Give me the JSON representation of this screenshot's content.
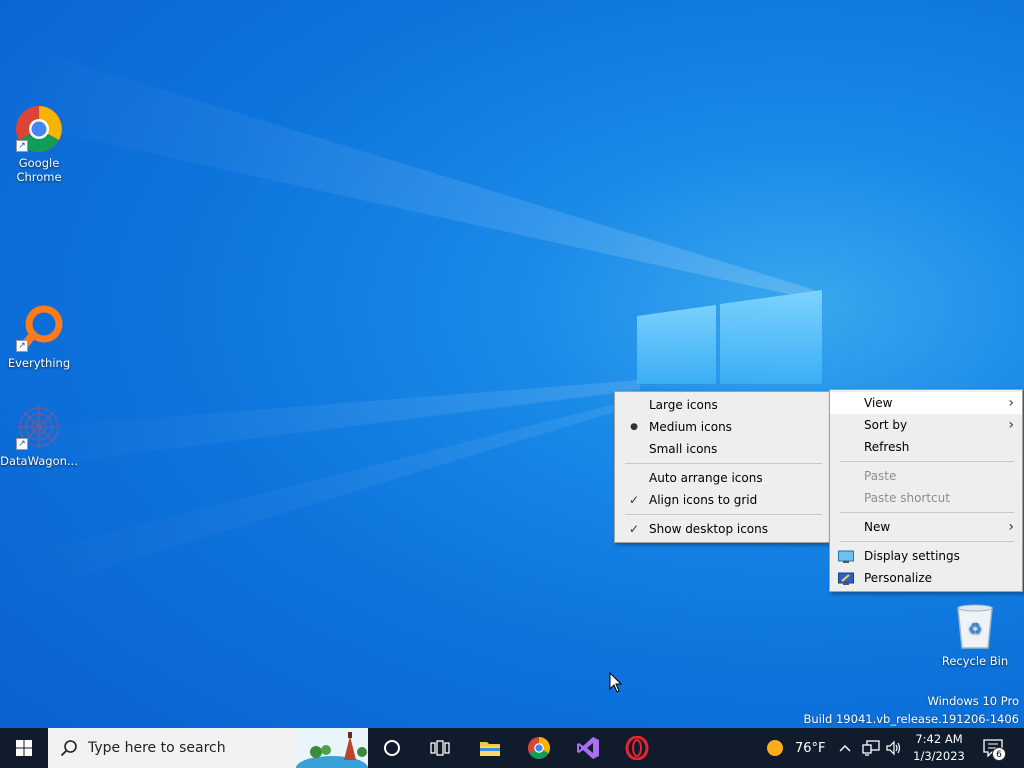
{
  "desktop": {
    "icons": [
      {
        "label": "Google\nChrome",
        "icon": "chrome-icon"
      },
      {
        "label": "Everything",
        "icon": "everything-search-icon"
      },
      {
        "label": "DataWagon...",
        "icon": "datawagon-icon"
      },
      {
        "label": "Recycle Bin",
        "icon": "recycle-bin-icon"
      }
    ],
    "watermark": {
      "line1": "Windows 10 Pro",
      "line2": "Build 19041.vb_release.191206-1406"
    }
  },
  "view_submenu": {
    "items": [
      {
        "label": "Large icons",
        "mark": ""
      },
      {
        "label": "Medium icons",
        "mark": "●"
      },
      {
        "label": "Small icons",
        "mark": ""
      },
      {
        "label": "Auto arrange icons",
        "mark": ""
      },
      {
        "label": "Align icons to grid",
        "mark": "✓"
      },
      {
        "label": "Show desktop icons",
        "mark": "✓"
      }
    ]
  },
  "context_menu": {
    "items": [
      {
        "label": "View",
        "submenu": true,
        "highlighted": true
      },
      {
        "label": "Sort by",
        "submenu": true
      },
      {
        "label": "Refresh"
      },
      {
        "label": "Paste",
        "disabled": true
      },
      {
        "label": "Paste shortcut",
        "disabled": true
      },
      {
        "label": "New",
        "submenu": true
      },
      {
        "label": "Display settings",
        "icon": "display-settings-icon"
      },
      {
        "label": "Personalize",
        "icon": "personalize-icon"
      }
    ]
  },
  "taskbar": {
    "search_placeholder": "Type here to search",
    "pinned": [
      "cortana-icon",
      "task-view-icon",
      "file-explorer-icon",
      "chrome-icon",
      "visual-studio-icon",
      "opera-icon"
    ],
    "weather": {
      "temp": "76°F",
      "icon": "sun-icon"
    },
    "clock": {
      "time": "7:42 AM",
      "date": "1/3/2023"
    },
    "notification_count": "6"
  },
  "colors": {
    "taskbar": "#101c2c",
    "menu_bg": "#eeeeee",
    "desktop_blue": "#0d74dc"
  }
}
